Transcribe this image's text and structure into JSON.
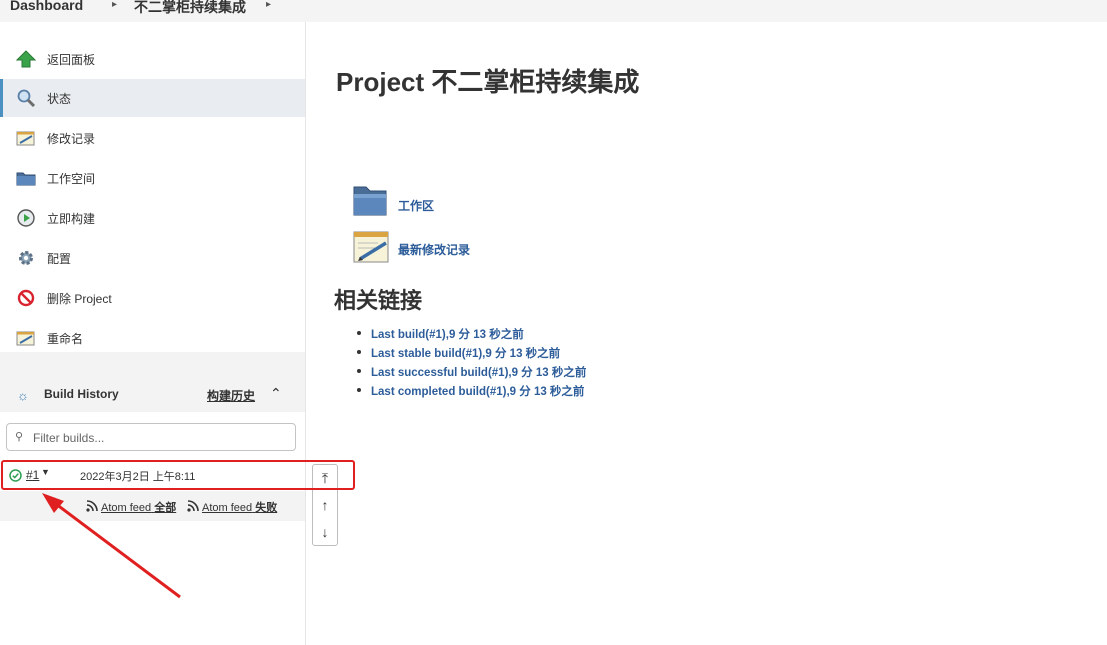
{
  "breadcrumb": {
    "items": [
      "Dashboard",
      "不二掌柜持续集成"
    ]
  },
  "sidebar": {
    "tasks": [
      {
        "label": "返回面板",
        "icon": "up-arrow-icon"
      },
      {
        "label": "状态",
        "icon": "search-icon",
        "active": true
      },
      {
        "label": "修改记录",
        "icon": "notepad-icon"
      },
      {
        "label": "工作空间",
        "icon": "folder-icon"
      },
      {
        "label": "立即构建",
        "icon": "clock-play-icon"
      },
      {
        "label": "配置",
        "icon": "gear-icon"
      },
      {
        "label": "删除 Project",
        "icon": "no-entry-icon"
      },
      {
        "label": "重命名",
        "icon": "notepad-icon"
      }
    ]
  },
  "build_history": {
    "title": "Build History",
    "trend_label": "构建历史",
    "filter_placeholder": "Filter builds...",
    "builds": [
      {
        "number": "#1",
        "date": "2022年3月2日 上午8:11",
        "status": "success"
      }
    ],
    "feeds": {
      "all_prefix": "Atom feed",
      "all_suffix": "全部",
      "fail_prefix": "Atom feed",
      "fail_suffix": "失败"
    }
  },
  "main": {
    "title": "Project 不二掌柜持续集成",
    "links": [
      {
        "label": "工作区",
        "icon": "folder-icon"
      },
      {
        "label": "最新修改记录",
        "icon": "notepad-icon"
      }
    ],
    "related_title": "相关链接",
    "related_links": [
      "Last build(#1),9 分 13 秒之前",
      "Last stable build(#1),9 分 13 秒之前",
      "Last successful build(#1),9 分 13 秒之前",
      "Last completed build(#1),9 分 13 秒之前"
    ]
  },
  "colors": {
    "link": "#2c5c99",
    "highlight": "#e02020",
    "success": "#2e9e52"
  }
}
